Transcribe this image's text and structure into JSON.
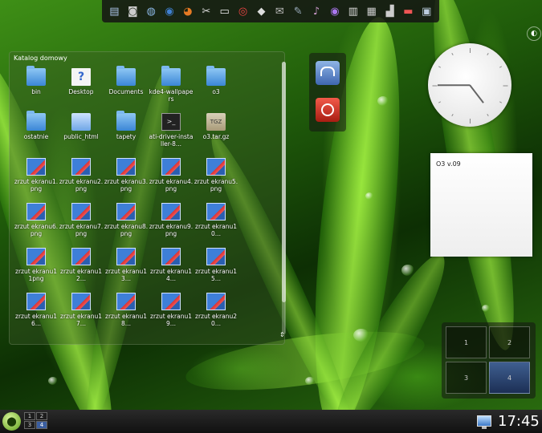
{
  "dock": {
    "icons": [
      "file-manager-icon",
      "camera-icon",
      "network-icon",
      "browser-icon",
      "firefox-icon",
      "tools-icon",
      "terminal-icon",
      "help-icon",
      "diamond-icon",
      "chat-icon",
      "wrench-icon",
      "media-player-icon",
      "eye-icon",
      "document-icon",
      "package-icon",
      "monitor-icon",
      "drive-icon",
      "desktop-icon"
    ]
  },
  "folder_view": {
    "title": "Katalog domowy",
    "items": [
      {
        "label": "bin",
        "type": "dir"
      },
      {
        "label": "Desktop",
        "type": "doc"
      },
      {
        "label": "Documents",
        "type": "dir"
      },
      {
        "label": "kde4-wallpapers",
        "type": "dir"
      },
      {
        "label": "o3",
        "type": "dir"
      },
      {
        "label": "ostatnie",
        "type": "dir"
      },
      {
        "label": "public_html",
        "type": "html"
      },
      {
        "label": "tapety",
        "type": "dir"
      },
      {
        "label": "ati-driver-installer-8...",
        "type": "term"
      },
      {
        "label": "o3.tar.gz",
        "type": "tgz"
      },
      {
        "label": "zrzut ekranu1.png",
        "type": "png"
      },
      {
        "label": "zrzut ekranu2.png",
        "type": "png"
      },
      {
        "label": "zrzut ekranu3.png",
        "type": "png"
      },
      {
        "label": "zrzut ekranu4.png",
        "type": "png"
      },
      {
        "label": "zrzut ekranu5.png",
        "type": "png"
      },
      {
        "label": "zrzut ekranu6.png",
        "type": "png"
      },
      {
        "label": "zrzut ekranu7.png",
        "type": "png"
      },
      {
        "label": "zrzut ekranu8.png",
        "type": "png"
      },
      {
        "label": "zrzut ekranu9.png",
        "type": "png"
      },
      {
        "label": "zrzut ekranu10...",
        "type": "png"
      },
      {
        "label": "zrzut ekranu11png",
        "type": "png"
      },
      {
        "label": "zrzut ekranu12...",
        "type": "png"
      },
      {
        "label": "zrzut ekranu13...",
        "type": "png"
      },
      {
        "label": "zrzut ekranu14...",
        "type": "png"
      },
      {
        "label": "zrzut ekranu15...",
        "type": "png"
      },
      {
        "label": "zrzut ekranu16...",
        "type": "png"
      },
      {
        "label": "zrzut ekranu17...",
        "type": "png"
      },
      {
        "label": "zrzut ekranu18...",
        "type": "png"
      },
      {
        "label": "zrzut ekranu19...",
        "type": "png"
      },
      {
        "label": "zrzut ekranu20...",
        "type": "png"
      }
    ]
  },
  "note": {
    "text": "O3 v.09"
  },
  "clock": {
    "hour": 4,
    "minute": 45
  },
  "pager": {
    "desktops": [
      "1",
      "2",
      "3",
      "4"
    ],
    "active": "4"
  },
  "taskbar": {
    "pager_desktops": [
      "1",
      "2",
      "3",
      "4"
    ],
    "active": "4",
    "time": "17:45"
  }
}
